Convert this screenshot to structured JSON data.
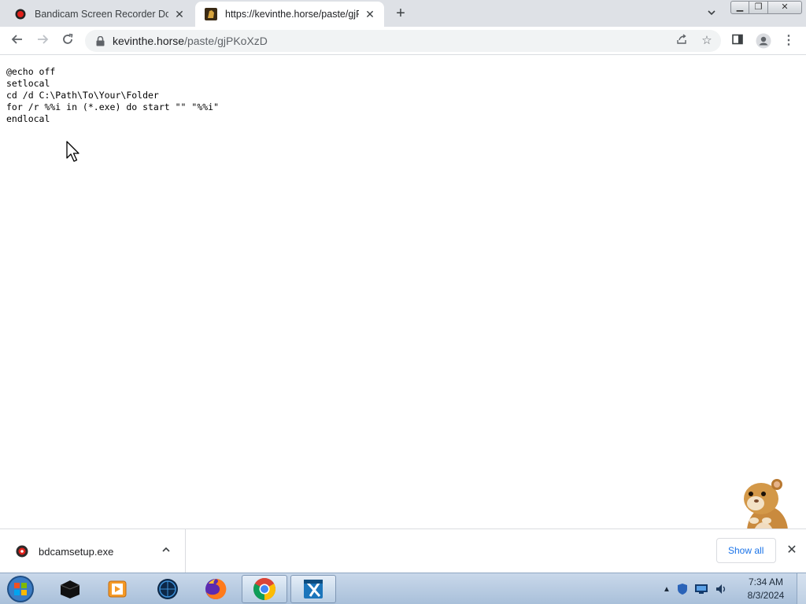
{
  "browser": {
    "tabs": [
      {
        "title": "Bandicam Screen Recorder Down",
        "favicon": "bandicam-icon",
        "active": false
      },
      {
        "title": "https://kevinthe.horse/paste/gjPK",
        "favicon": "horse-site-icon",
        "active": true
      }
    ],
    "new_tab_icon": "+",
    "address": {
      "host": "kevinthe.horse",
      "path": "/paste/gjPKoXzD"
    }
  },
  "page": {
    "code_lines": [
      "@echo off",
      "setlocal",
      "cd /d C:\\Path\\To\\Your\\Folder",
      "for /r %%i in (*.exe) do start \"\" \"%%i\"",
      "endlocal"
    ]
  },
  "download_shelf": {
    "file_name": "bdcamsetup.exe",
    "show_all_label": "Show all"
  },
  "taskbar": {
    "apps": [
      "windows-explorer",
      "media-player",
      "app-globe",
      "firefox",
      "chrome",
      "video-editor"
    ],
    "clock_time": "7:34 AM",
    "clock_date": "8/3/2024"
  },
  "colors": {
    "tab_strip": "#dee1e6",
    "omnibox": "#f1f3f4",
    "link_blue": "#1a73e8",
    "taskbar": "#b8cde3"
  }
}
